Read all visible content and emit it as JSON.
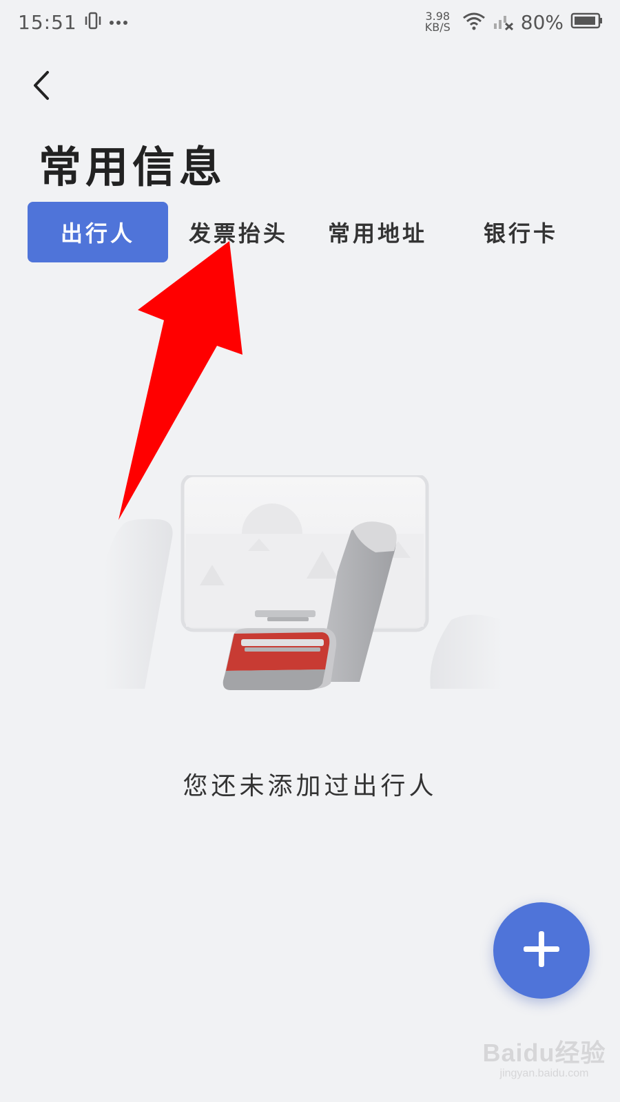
{
  "status_bar": {
    "time": "15:51",
    "net_speed_value": "3.98",
    "net_speed_unit": "KB/S",
    "battery": "80%",
    "icons": [
      "vibrate-icon",
      "more-dots-icon",
      "wifi-icon",
      "signal-off-icon",
      "battery-icon"
    ]
  },
  "header": {
    "back_icon": "back-chevron-icon",
    "title": "常用信息"
  },
  "tabs": [
    {
      "label": "出行人",
      "active": true
    },
    {
      "label": "发票抬头",
      "active": false
    },
    {
      "label": "常用地址",
      "active": false
    },
    {
      "label": "银行卡",
      "active": false
    }
  ],
  "empty_state": {
    "illustration": "train-seat-illustration",
    "message": "您还未添加过出行人"
  },
  "fab": {
    "icon": "plus-icon"
  },
  "annotation": {
    "icon": "red-arrow-pointer"
  },
  "watermark": {
    "logo": "Baidu经验",
    "site": "jingyan.baidu.com"
  },
  "colors": {
    "accent": "#4f74d9",
    "background": "#f1f2f4",
    "arrow": "#ff0000"
  }
}
